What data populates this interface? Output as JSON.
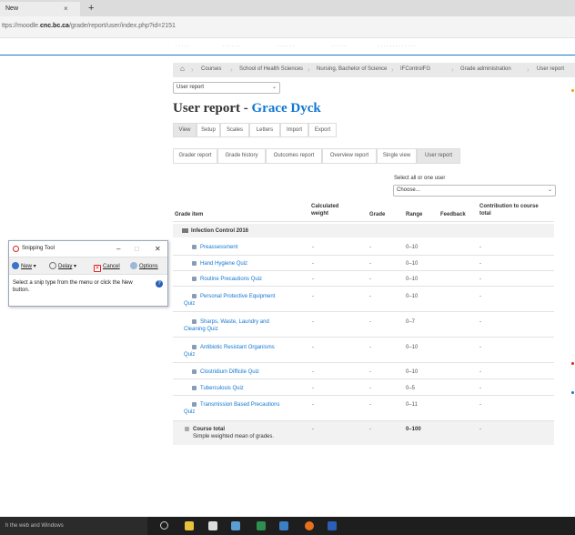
{
  "browser": {
    "tab_title": "New",
    "tab_close": "×",
    "new_tab": "+",
    "url_prefix": "ttps://moodle.",
    "url_domain": "cnc.bc.ca",
    "url_path": "/grade/report/user/index.php?id=2151"
  },
  "breadcrumb": {
    "home_icon": "home-icon",
    "items": [
      "Courses",
      "School of Health Sciences",
      "Nursing, Bachelor of Science",
      "IFControlFG",
      "Grade administration",
      "User report"
    ]
  },
  "report_select": {
    "value": "User report"
  },
  "title": {
    "prefix": "User report - ",
    "name": "Grace Dyck"
  },
  "primary_tabs": [
    "View",
    "Setup",
    "Scales",
    "Letters",
    "Import",
    "Export"
  ],
  "secondary_tabs": [
    "Grader report",
    "Grade history",
    "Outcomes report",
    "Overview report",
    "Single view",
    "User report"
  ],
  "user_select": {
    "label": "Select all or one user",
    "value": "Choose..."
  },
  "table": {
    "headers": {
      "item": "Grade item",
      "calc1": "Calculated",
      "calc2": "weight",
      "grade": "Grade",
      "range": "Range",
      "feedback": "Feedback",
      "contrib1": "Contribution to course",
      "contrib2": "total"
    },
    "category": "Infection Control 2016",
    "rows": [
      {
        "l1": "Preassessment",
        "l2": "",
        "weight": "-",
        "grade": "-",
        "range": "0–10",
        "contrib": "-"
      },
      {
        "l1": "Hand Hygiene Quiz",
        "l2": "",
        "weight": "-",
        "grade": "-",
        "range": "0–10",
        "contrib": "-"
      },
      {
        "l1": "Routine Precautions Quiz",
        "l2": "",
        "weight": "-",
        "grade": "-",
        "range": "0–10",
        "contrib": "-"
      },
      {
        "l1": "Personal Protective Equipment",
        "l2": "Quiz",
        "weight": "-",
        "grade": "-",
        "range": "0–10",
        "contrib": "-"
      },
      {
        "l1": "Sharps, Waste, Laundry and",
        "l2": "Cleaning Quiz",
        "weight": "-",
        "grade": "-",
        "range": "0–7",
        "contrib": "-"
      },
      {
        "l1": "Antibiotic Resistant Organisms",
        "l2": "Quiz",
        "weight": "-",
        "grade": "-",
        "range": "0–10",
        "contrib": "-"
      },
      {
        "l1": "Clostridium Difficile Quiz",
        "l2": "",
        "weight": "-",
        "grade": "-",
        "range": "0–10",
        "contrib": "-"
      },
      {
        "l1": "Tuberculosis Quiz",
        "l2": "",
        "weight": "-",
        "grade": "-",
        "range": "0–5",
        "contrib": "-"
      },
      {
        "l1": "Transmission Based Precautions",
        "l2": "Quiz",
        "weight": "-",
        "grade": "-",
        "range": "0–11",
        "contrib": "-"
      }
    ],
    "total": {
      "l1": "Course total",
      "l2": "Simple weighted mean of grades.",
      "weight": "-",
      "grade": "-",
      "range": "0–100",
      "contrib": "-"
    }
  },
  "snipping_tool": {
    "title": "Snipping Tool",
    "minimize": "–",
    "maximize": "□",
    "close": "✕",
    "new": "New",
    "delay": "Delay",
    "cancel": "Cancel",
    "options": "Options",
    "message": "Select a snip type from the menu or click the New button.",
    "help": "?"
  },
  "taskbar": {
    "search_placeholder": "h the web and Windows"
  },
  "colors": {
    "accent": "#1177d1",
    "link": "#1177d1",
    "taskbar": "#1e1e1e"
  }
}
